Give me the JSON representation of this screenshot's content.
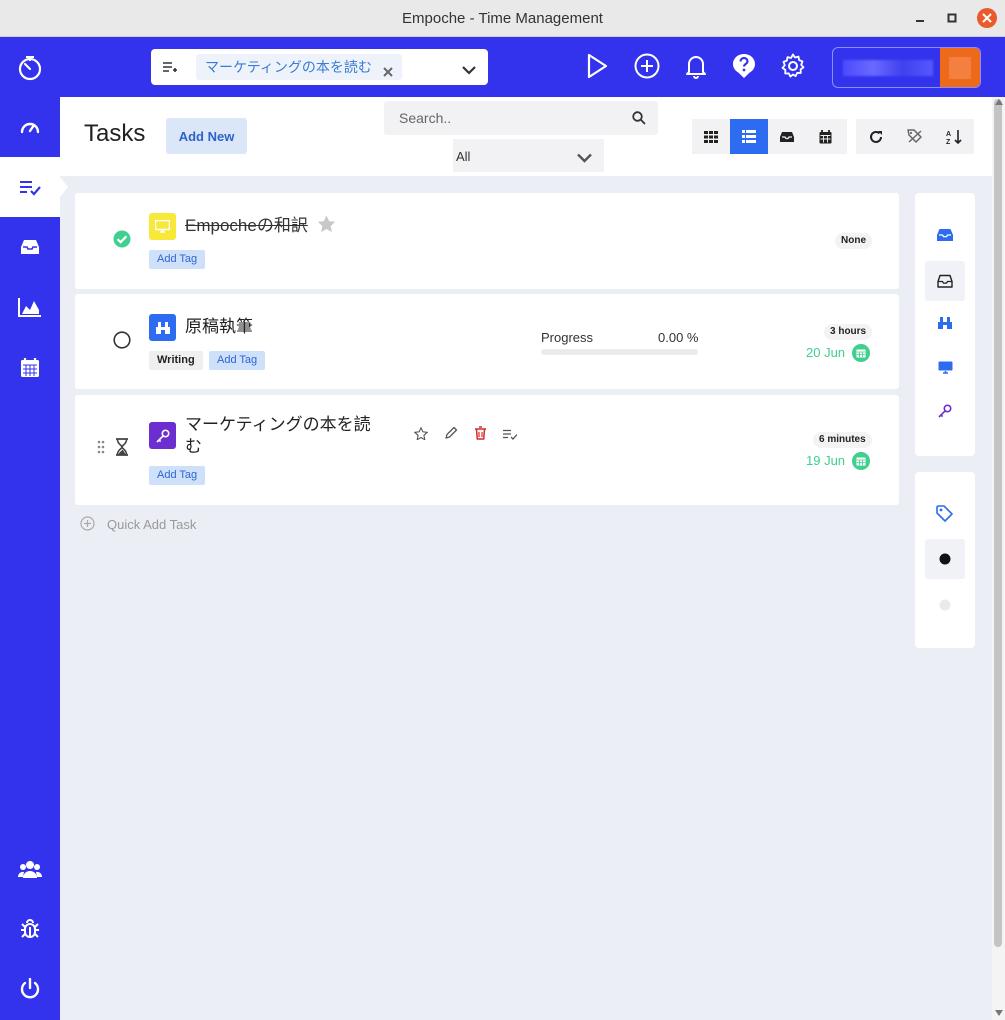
{
  "window": {
    "title": "Empoche - Time Management"
  },
  "topbar": {
    "project_chip": "マーケティングの本を読む"
  },
  "page": {
    "title": "Tasks",
    "add_new": "Add New"
  },
  "search": {
    "placeholder": "Search..",
    "filter_value": "All"
  },
  "tasks": [
    {
      "name": "Empocheの和訳",
      "completed": true,
      "project_icon": "monitor-icon",
      "project_color": "#f7e83a",
      "add_tag": "Add Tag",
      "due_badge": "None"
    },
    {
      "name": "原稿執筆",
      "completed": false,
      "project_icon": "binoculars-icon",
      "project_color": "#2d6cf0",
      "tag": "Writing",
      "add_tag": "Add Tag",
      "progress_label": "Progress",
      "progress_value": "0.00 %",
      "progress": 0.0,
      "estimate": "3 hours",
      "due_date": "20 Jun"
    },
    {
      "name": "マーケティングの本を読む",
      "completed": false,
      "in_progress": true,
      "project_icon": "key-icon",
      "project_color": "#6d2ecf",
      "add_tag": "Add Tag",
      "estimate": "6 minutes",
      "due_date": "19 Jun"
    }
  ],
  "quick_add": {
    "label": "Quick Add Task"
  },
  "colors": {
    "primary": "#3333ee",
    "accent": "#2d6cf0",
    "success": "#3fcf8e",
    "danger": "#d42a2a"
  }
}
